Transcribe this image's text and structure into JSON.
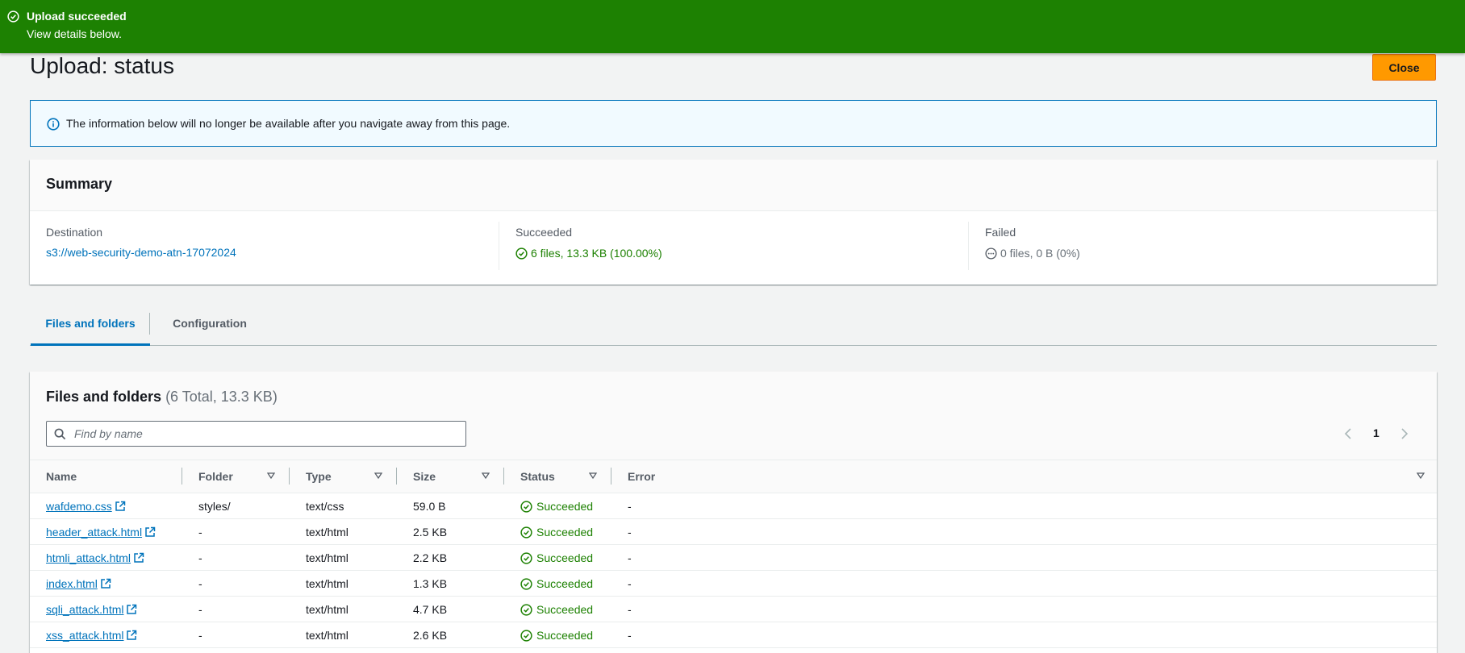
{
  "flash": {
    "title": "Upload succeeded",
    "message": "View details below.",
    "color": "#1d8102",
    "icon": "check-circle-icon"
  },
  "header": {
    "title": "Upload: status",
    "close_label": "Close"
  },
  "info_alert": {
    "icon": "info-icon",
    "text": "The information below will no longer be available after you navigate away from this page."
  },
  "summary": {
    "heading": "Summary",
    "destination": {
      "label": "Destination",
      "value": "s3://web-security-demo-atn-17072024"
    },
    "succeeded": {
      "label": "Succeeded",
      "value": "6 files, 13.3 KB (100.00%)",
      "icon": "check-circle-icon"
    },
    "failed": {
      "label": "Failed",
      "value": "0 files, 0 B (0%)",
      "icon": "ellipsis-circle-icon"
    }
  },
  "tabs": [
    {
      "label": "Files and folders",
      "active": true
    },
    {
      "label": "Configuration",
      "active": false
    }
  ],
  "files": {
    "heading": "Files and folders",
    "count": "(6 Total, 13.3 KB)",
    "search_placeholder": "Find by name",
    "page": "1",
    "columns": [
      "Name",
      "Folder",
      "Type",
      "Size",
      "Status",
      "Error"
    ],
    "rows": [
      {
        "name": "wafdemo.css",
        "folder": "styles/",
        "type": "text/css",
        "size": "59.0 B",
        "status": "Succeeded",
        "error": "-"
      },
      {
        "name": "header_attack.html",
        "folder": "-",
        "type": "text/html",
        "size": "2.5 KB",
        "status": "Succeeded",
        "error": "-"
      },
      {
        "name": "htmli_attack.html",
        "folder": "-",
        "type": "text/html",
        "size": "2.2 KB",
        "status": "Succeeded",
        "error": "-"
      },
      {
        "name": "index.html",
        "folder": "-",
        "type": "text/html",
        "size": "1.3 KB",
        "status": "Succeeded",
        "error": "-"
      },
      {
        "name": "sqli_attack.html",
        "folder": "-",
        "type": "text/html",
        "size": "4.7 KB",
        "status": "Succeeded",
        "error": "-"
      },
      {
        "name": "xss_attack.html",
        "folder": "-",
        "type": "text/html",
        "size": "2.6 KB",
        "status": "Succeeded",
        "error": "-"
      }
    ]
  },
  "colors": {
    "success": "#1d8102",
    "link": "#0073bb",
    "primary_button": "#ff9900",
    "info_border": "#0073bb"
  }
}
